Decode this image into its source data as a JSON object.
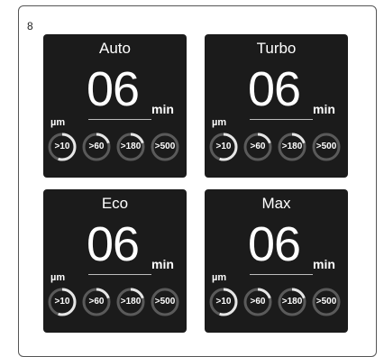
{
  "page_number": "8",
  "unit_label": "min",
  "particle_unit": "µm",
  "panels": [
    {
      "mode": "Auto",
      "time": "06",
      "gauges": [
        {
          "label": ">10",
          "level": 0.55
        },
        {
          "label": ">60",
          "level": 0.2
        },
        {
          "label": ">180",
          "level": 0.2
        },
        {
          "label": ">500",
          "level": 0
        }
      ]
    },
    {
      "mode": "Turbo",
      "time": "06",
      "gauges": [
        {
          "label": ">10",
          "level": 0.55
        },
        {
          "label": ">60",
          "level": 0.2
        },
        {
          "label": ">180",
          "level": 0.2
        },
        {
          "label": ">500",
          "level": 0
        }
      ]
    },
    {
      "mode": "Eco",
      "time": "06",
      "gauges": [
        {
          "label": ">10",
          "level": 0.55
        },
        {
          "label": ">60",
          "level": 0.2
        },
        {
          "label": ">180",
          "level": 0.2
        },
        {
          "label": ">500",
          "level": 0
        }
      ]
    },
    {
      "mode": "Max",
      "time": "06",
      "gauges": [
        {
          "label": ">10",
          "level": 0.55
        },
        {
          "label": ">60",
          "level": 0.2
        },
        {
          "label": ">180",
          "level": 0.2
        },
        {
          "label": ">500",
          "level": 0
        }
      ]
    }
  ],
  "colors": {
    "panel": "#1b1b1b",
    "gauge_track": "#5a5a5a",
    "gauge_fill": "#e6e6e6"
  }
}
